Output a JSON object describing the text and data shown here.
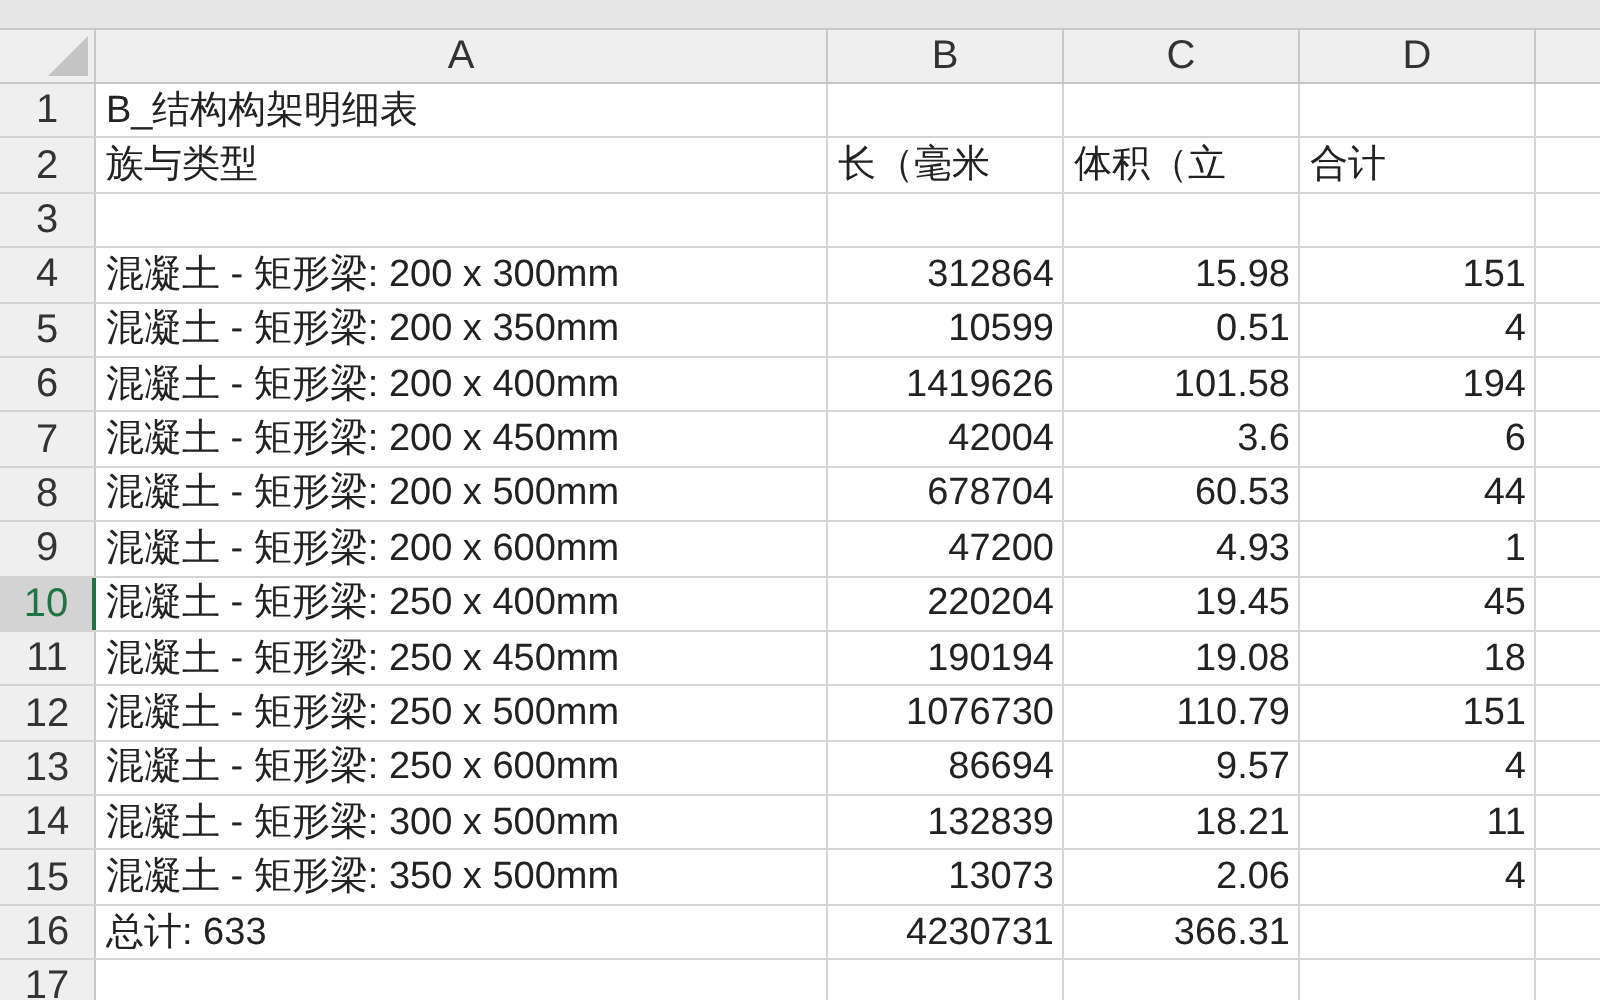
{
  "columns": [
    "A",
    "B",
    "C",
    "D"
  ],
  "rows": [
    {
      "number": "1",
      "kind": "text",
      "selected": false,
      "cells": {
        "A": "B_结构构架明细表"
      }
    },
    {
      "number": "2",
      "kind": "text",
      "selected": false,
      "cells": {
        "A": "族与类型",
        "B": "长（毫米",
        "C": "体积（立",
        "D": "合计"
      }
    },
    {
      "number": "3",
      "kind": "text",
      "selected": false,
      "cells": {}
    },
    {
      "number": "4",
      "kind": "data",
      "selected": false,
      "cells": {
        "A": "混凝土 - 矩形梁: 200 x 300mm",
        "B": "312864",
        "C": "15.98",
        "D": "151"
      }
    },
    {
      "number": "5",
      "kind": "data",
      "selected": false,
      "cells": {
        "A": "混凝土 - 矩形梁: 200 x 350mm",
        "B": "10599",
        "C": "0.51",
        "D": "4"
      }
    },
    {
      "number": "6",
      "kind": "data",
      "selected": false,
      "cells": {
        "A": "混凝土 - 矩形梁: 200 x 400mm",
        "B": "1419626",
        "C": "101.58",
        "D": "194"
      }
    },
    {
      "number": "7",
      "kind": "data",
      "selected": false,
      "cells": {
        "A": "混凝土 - 矩形梁: 200 x 450mm",
        "B": "42004",
        "C": "3.6",
        "D": "6"
      }
    },
    {
      "number": "8",
      "kind": "data",
      "selected": false,
      "cells": {
        "A": "混凝土 - 矩形梁: 200 x 500mm",
        "B": "678704",
        "C": "60.53",
        "D": "44"
      }
    },
    {
      "number": "9",
      "kind": "data",
      "selected": false,
      "cells": {
        "A": "混凝土 - 矩形梁: 200 x 600mm",
        "B": "47200",
        "C": "4.93",
        "D": "1"
      }
    },
    {
      "number": "10",
      "kind": "data",
      "selected": true,
      "cells": {
        "A": "混凝土 - 矩形梁: 250 x 400mm",
        "B": "220204",
        "C": "19.45",
        "D": "45"
      }
    },
    {
      "number": "11",
      "kind": "data",
      "selected": false,
      "cells": {
        "A": "混凝土 - 矩形梁: 250 x 450mm",
        "B": "190194",
        "C": "19.08",
        "D": "18"
      }
    },
    {
      "number": "12",
      "kind": "data",
      "selected": false,
      "cells": {
        "A": "混凝土 - 矩形梁: 250 x 500mm",
        "B": "1076730",
        "C": "110.79",
        "D": "151"
      }
    },
    {
      "number": "13",
      "kind": "data",
      "selected": false,
      "cells": {
        "A": "混凝土 - 矩形梁: 250 x 600mm",
        "B": "86694",
        "C": "9.57",
        "D": "4"
      }
    },
    {
      "number": "14",
      "kind": "data",
      "selected": false,
      "cells": {
        "A": "混凝土 - 矩形梁: 300 x 500mm",
        "B": "132839",
        "C": "18.21",
        "D": "11"
      }
    },
    {
      "number": "15",
      "kind": "data",
      "selected": false,
      "cells": {
        "A": "混凝土 - 矩形梁: 350 x 500mm",
        "B": "13073",
        "C": "2.06",
        "D": "4"
      }
    },
    {
      "number": "16",
      "kind": "data",
      "selected": false,
      "cells": {
        "A": "总计: 633",
        "B": "4230731",
        "C": "366.31"
      }
    },
    {
      "number": "17",
      "kind": "text",
      "selected": false,
      "cells": {}
    }
  ]
}
